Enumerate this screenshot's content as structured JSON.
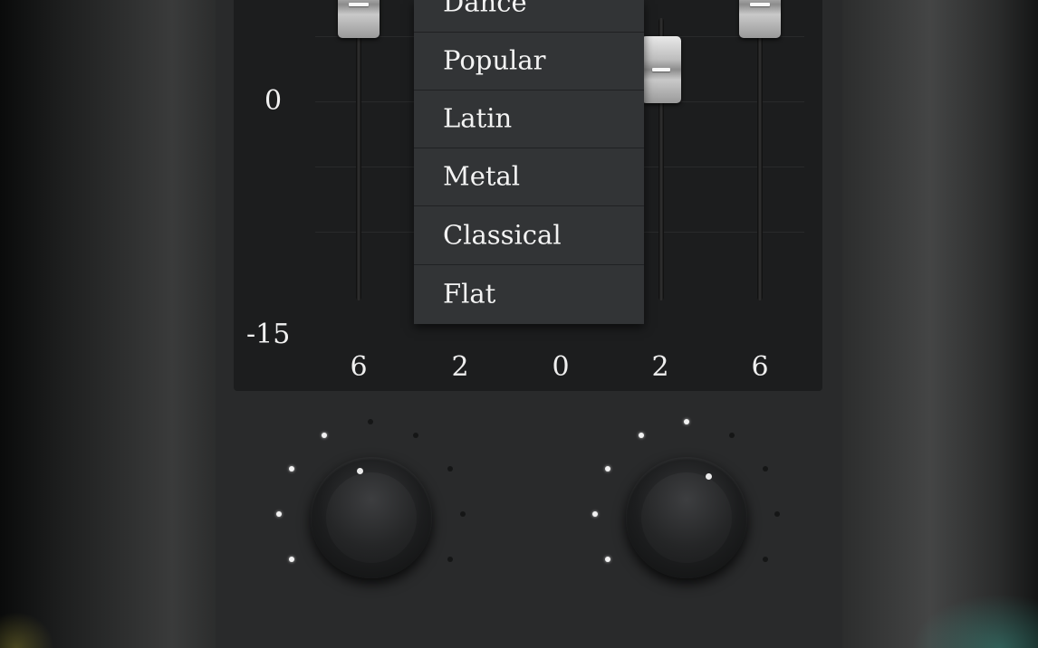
{
  "equalizer": {
    "db_scale": {
      "mid": "0",
      "min": "-15"
    },
    "band_labels": [
      "6",
      "2",
      "0",
      "2",
      "6"
    ]
  },
  "preset_dropdown": {
    "items": [
      "Dance",
      "Popular",
      "Latin",
      "Metal",
      "Classical",
      "Flat"
    ]
  },
  "knobs": [
    {
      "name": "left-knob",
      "level_ticks_lit": 4,
      "level_ticks_total": 9
    },
    {
      "name": "right-knob",
      "level_ticks_lit": 5,
      "level_ticks_total": 9
    }
  ],
  "colors": {
    "panel": "#292a2b",
    "eq_background": "#1c1d1e",
    "dropdown": "#323436",
    "text": "#f1f1f1"
  }
}
